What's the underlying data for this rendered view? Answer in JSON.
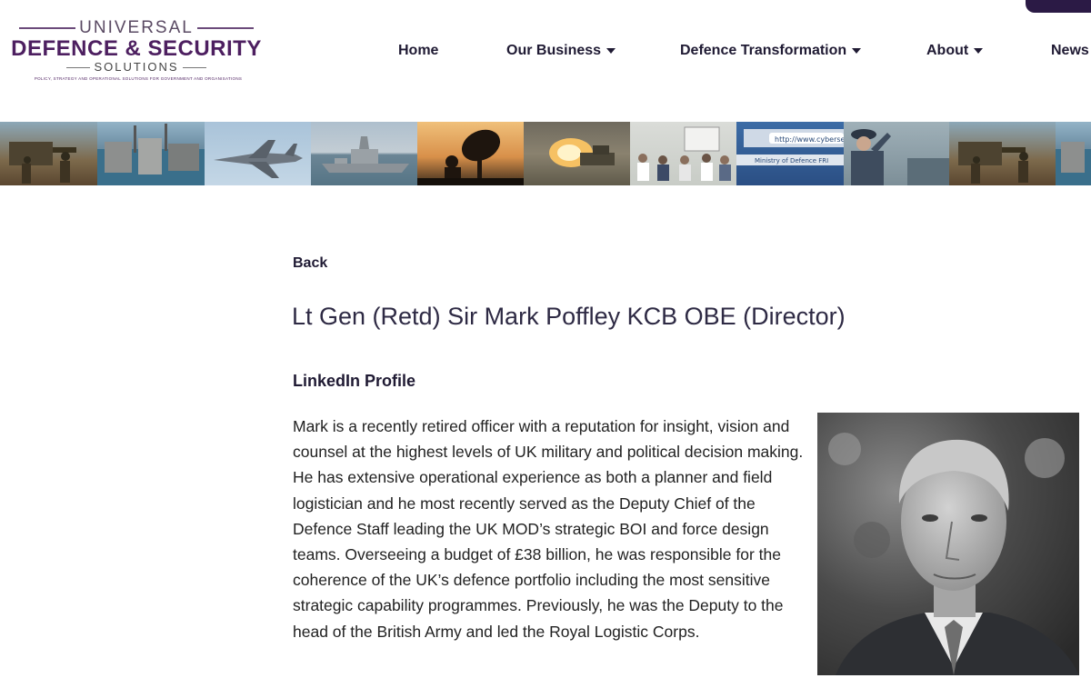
{
  "logo": {
    "line1": "UNIVERSAL",
    "line2": "DEFENCE & SECURITY",
    "line3": "SOLUTIONS",
    "tagline": "POLICY, STRATEGY AND OPERATIONAL SOLUTIONS FOR GOVERNMENT AND ORGANISATIONS"
  },
  "nav": {
    "home": "Home",
    "our_business": "Our Business",
    "defence_transformation": "Defence Transformation",
    "about": "About",
    "news": "News"
  },
  "banner": {
    "tiles": [
      "soldiers-icon",
      "naval-dockyard-icon",
      "fighter-jet-icon",
      "warship-icon",
      "satellite-dish-icon",
      "artillery-fire-icon",
      "meeting-room-icon",
      "cybersecurity-browser-icon",
      "saluting-officer-icon",
      "soldiers-icon",
      "naval-dockyard-icon"
    ]
  },
  "content": {
    "back": "Back",
    "title": "Lt Gen (Retd) Sir Mark Poffley KCB OBE (Director)",
    "linkedin": "LinkedIn Profile",
    "bio": "Mark is a recently retired officer with a reputation for insight, vision and counsel at the highest levels of UK military and political decision making. He has extensive operational experience as both a planner and field logistician and he most recently served as the Deputy Chief of the Defence Staff leading the UK MOD’s strategic BOI and force design teams. Overseeing a budget of £38 billion, he was responsible for the coherence of the UK’s defence portfolio including the most sensitive strategic capability programmes. Previously, he was the Deputy to the head of the British Army and led the Royal Logistic Corps."
  },
  "colors": {
    "brand_purple": "#4d1f60",
    "nav_text": "#1f1a33",
    "top_tab": "#2b1a45"
  }
}
